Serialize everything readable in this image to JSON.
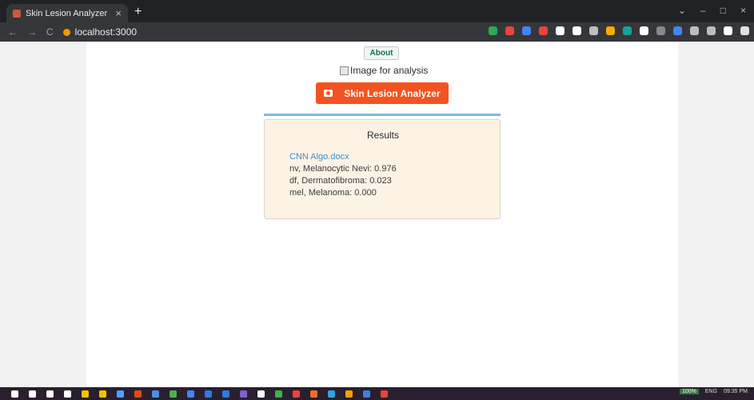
{
  "browser": {
    "tab_title": "Skin Lesion Analyzer",
    "tab_close": "×",
    "new_tab": "+",
    "url": "localhost:3000",
    "nav": {
      "back": "←",
      "forward": "→",
      "reload": "C"
    },
    "window_controls": {
      "dropdown": "⌄",
      "minimize": "–",
      "maximize": "□",
      "close": "×"
    },
    "extension_colors": [
      "#34a853",
      "#e8453c",
      "#4285f4",
      "#e8453c",
      "#ffffff",
      "#ffffff",
      "#bdbdbd",
      "#f9ab00",
      "#18a0a0",
      "#ffffff",
      "#888888",
      "#4285f4",
      "#bdbdbd",
      "#bdbdbd",
      "#ffffff",
      "#e0e0e0"
    ]
  },
  "page": {
    "about_label": "About",
    "image_alt": "Image for analysis",
    "analyze_label": "Skin Lesion Analyzer",
    "results": {
      "title": "Results",
      "file_name": "CNN Algo.docx",
      "lines": [
        "nv, Melanocytic Nevi: 0.976",
        "df, Dermatofibroma: 0.023",
        "mel, Melanoma: 0.000"
      ]
    },
    "colors": {
      "accent": "#f35321",
      "divider": "#7db9e0",
      "panel_bg": "#fcf3e5",
      "link": "#3b8fd6"
    }
  },
  "taskbar": {
    "zoom": "100%",
    "language": "ENG",
    "time": "09:35 PM",
    "app_colors": [
      "#ffffff",
      "#ffffff",
      "#ffffff",
      "#ffffff",
      "#f2c200",
      "#f2c200",
      "#4ea1ff",
      "#e64a19",
      "#4a90e2",
      "#4caf50",
      "#4285f4",
      "#2f7ad6",
      "#2f7ad6",
      "#7f5fd1",
      "#ffffff",
      "#42b14a",
      "#e8453c",
      "#f06d2c",
      "#2aa6e0",
      "#f4a000",
      "#3f7de8",
      "#e8453c"
    ]
  }
}
